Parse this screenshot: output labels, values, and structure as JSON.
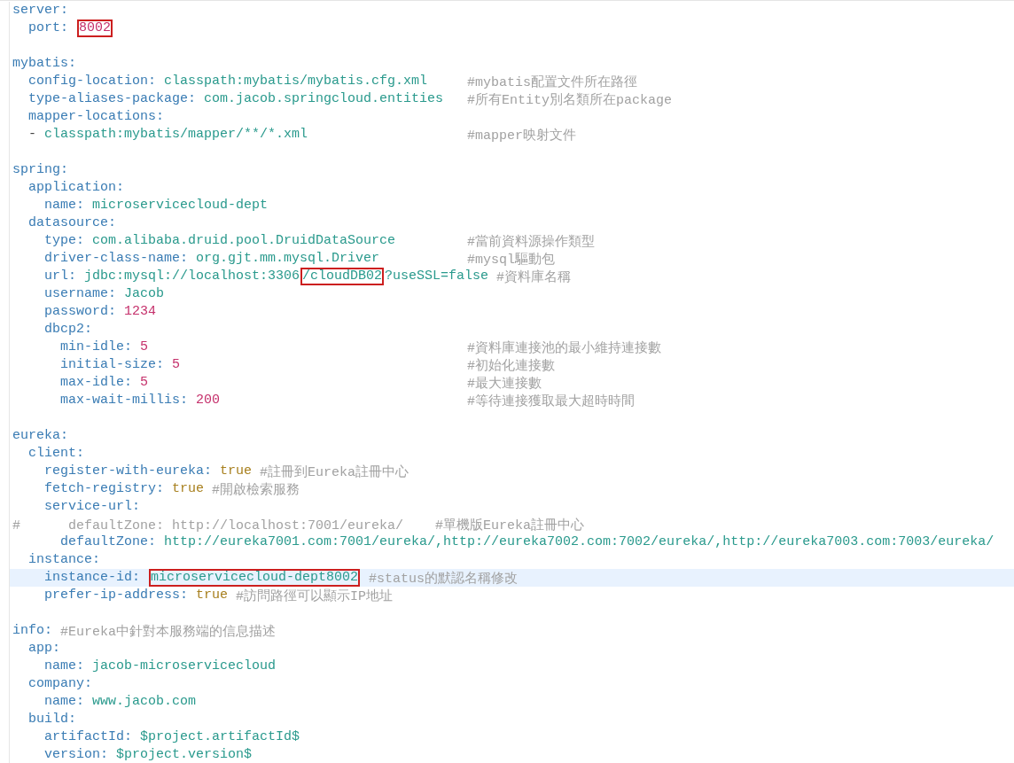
{
  "editor": {
    "items": [
      {
        "kind": "pair",
        "key": "server:",
        "children": [
          {
            "kind": "pair",
            "key": "port:",
            "value": {
              "kind": "number",
              "text": "8002",
              "boxed": true
            }
          }
        ]
      },
      {
        "kind": "pair",
        "key": "mybatis:",
        "children": [
          {
            "kind": "pair",
            "key": "config-location:",
            "value": {
              "kind": "string",
              "text": "classpath:mybatis/mybatis.cfg.xml"
            },
            "comment": {
              "kind": "column",
              "text": "#mybatis配置文件所在路徑"
            }
          },
          {
            "kind": "pair",
            "key": "type-aliases-package:",
            "value": {
              "kind": "string",
              "text": "com.jacob.springcloud.entities"
            },
            "comment": {
              "kind": "column",
              "text": "#所有Entity別名類所在package"
            }
          },
          {
            "kind": "pair",
            "key": "mapper-locations:",
            "children": [
              {
                "kind": "list_item",
                "marker": "-",
                "value": {
                  "kind": "string",
                  "text": "classpath:mybatis/mapper/**/*.xml"
                },
                "comment": {
                  "kind": "column",
                  "text": "#mapper映射文件"
                }
              }
            ]
          }
        ]
      },
      {
        "kind": "pair",
        "key": "spring:",
        "children": [
          {
            "kind": "pair",
            "key": "application:",
            "children": [
              {
                "kind": "pair",
                "key": "name:",
                "value": {
                  "kind": "string",
                  "text": "microservicecloud-dept"
                }
              }
            ]
          },
          {
            "kind": "pair",
            "key": "datasource:",
            "children": [
              {
                "kind": "pair",
                "key": "type:",
                "value": {
                  "kind": "string",
                  "text": "com.alibaba.druid.pool.DruidDataSource"
                },
                "comment": {
                  "kind": "column",
                  "text": "#當前資料源操作類型"
                }
              },
              {
                "kind": "pair",
                "key": "driver-class-name:",
                "value": {
                  "kind": "string",
                  "text": "org.gjt.mm.mysql.Driver"
                },
                "comment": {
                  "kind": "column",
                  "text": "#mysql驅動包"
                }
              },
              {
                "kind": "pair",
                "key": "url:",
                "value": {
                  "kind": "string",
                  "parts": [
                    {
                      "text": "jdbc:mysql://localhost:3306",
                      "boxed": false
                    },
                    {
                      "text": "/cloudDB02",
                      "boxed": true
                    },
                    {
                      "text": "?useSSL=false",
                      "boxed": false
                    }
                  ]
                },
                "comment": {
                  "kind": "inline",
                  "text": "#資料庫名稱"
                }
              },
              {
                "kind": "pair",
                "key": "username:",
                "value": {
                  "kind": "string",
                  "text": "Jacob"
                }
              },
              {
                "kind": "pair",
                "key": "password:",
                "value": {
                  "kind": "number",
                  "text": "1234"
                }
              },
              {
                "kind": "pair",
                "key": "dbcp2:",
                "children": [
                  {
                    "kind": "pair",
                    "key": "min-idle:",
                    "value": {
                      "kind": "number",
                      "text": "5"
                    },
                    "comment": {
                      "kind": "column",
                      "text": "#資料庫連接池的最小維持連接數"
                    }
                  },
                  {
                    "kind": "pair",
                    "key": "initial-size:",
                    "value": {
                      "kind": "number",
                      "text": "5"
                    },
                    "comment": {
                      "kind": "column",
                      "text": "#初始化連接數"
                    }
                  },
                  {
                    "kind": "pair",
                    "key": "max-idle:",
                    "value": {
                      "kind": "number",
                      "text": "5"
                    },
                    "comment": {
                      "kind": "column",
                      "text": "#最大連接數"
                    }
                  },
                  {
                    "kind": "pair",
                    "key": "max-wait-millis:",
                    "value": {
                      "kind": "number",
                      "text": "200"
                    },
                    "comment": {
                      "kind": "column",
                      "text": "#等待連接獲取最大超時時間"
                    }
                  }
                ]
              }
            ]
          }
        ]
      },
      {
        "kind": "pair",
        "key": "eureka:",
        "children": [
          {
            "kind": "pair",
            "key": "client:",
            "children": [
              {
                "kind": "pair",
                "key": "register-with-eureka:",
                "value": {
                  "kind": "boolean",
                  "text": "true"
                },
                "comment": {
                  "kind": "inline",
                  "text": "#註冊到Eureka註冊中心"
                }
              },
              {
                "kind": "pair",
                "key": "fetch-registry:",
                "value": {
                  "kind": "boolean",
                  "text": "true"
                },
                "comment": {
                  "kind": "inline",
                  "text": "#開啟檢索服務"
                }
              },
              {
                "kind": "pair",
                "key": "service-url:",
                "children": [
                  {
                    "kind": "comment_line",
                    "text": "#      defaultZone: http://localhost:7001/eureka/    #單機版Eureka註冊中心"
                  },
                  {
                    "kind": "pair",
                    "key": "defaultZone:",
                    "value": {
                      "kind": "string",
                      "text": "http://eureka7001.com:7001/eureka/,http://eureka7002.com:7002/eureka/,http://eureka7003.com:7003/eureka/"
                    }
                  }
                ]
              }
            ]
          },
          {
            "kind": "pair",
            "key": "instance:",
            "children": [
              {
                "kind": "pair",
                "key": "instance-id:",
                "current": true,
                "value": {
                  "kind": "string",
                  "text": "microservicecloud-dept8002",
                  "boxed": true
                },
                "comment": {
                  "kind": "inline",
                  "text": "#status的默認名稱修改"
                }
              },
              {
                "kind": "pair",
                "key": "prefer-ip-address:",
                "value": {
                  "kind": "boolean",
                  "text": "true"
                },
                "comment": {
                  "kind": "inline",
                  "text": "#訪問路徑可以顯示IP地址"
                }
              }
            ]
          }
        ]
      },
      {
        "kind": "pair",
        "key": "info:",
        "comment": {
          "kind": "inline",
          "text": "#Eureka中針對本服務端的信息描述"
        },
        "children": [
          {
            "kind": "pair",
            "key": "app:",
            "children": [
              {
                "kind": "pair",
                "key": "name:",
                "value": {
                  "kind": "string",
                  "text": "jacob-microservicecloud"
                }
              }
            ]
          },
          {
            "kind": "pair",
            "key": "company:",
            "children": [
              {
                "kind": "pair",
                "key": "name:",
                "value": {
                  "kind": "string",
                  "text": "www.jacob.com"
                }
              }
            ]
          },
          {
            "kind": "pair",
            "key": "build:",
            "children": [
              {
                "kind": "pair",
                "key": "artifactId:",
                "value": {
                  "kind": "string",
                  "text": "$project.artifactId$"
                }
              },
              {
                "kind": "pair",
                "key": "version:",
                "value": {
                  "kind": "string",
                  "text": "$project.version$"
                }
              }
            ]
          }
        ]
      }
    ]
  }
}
